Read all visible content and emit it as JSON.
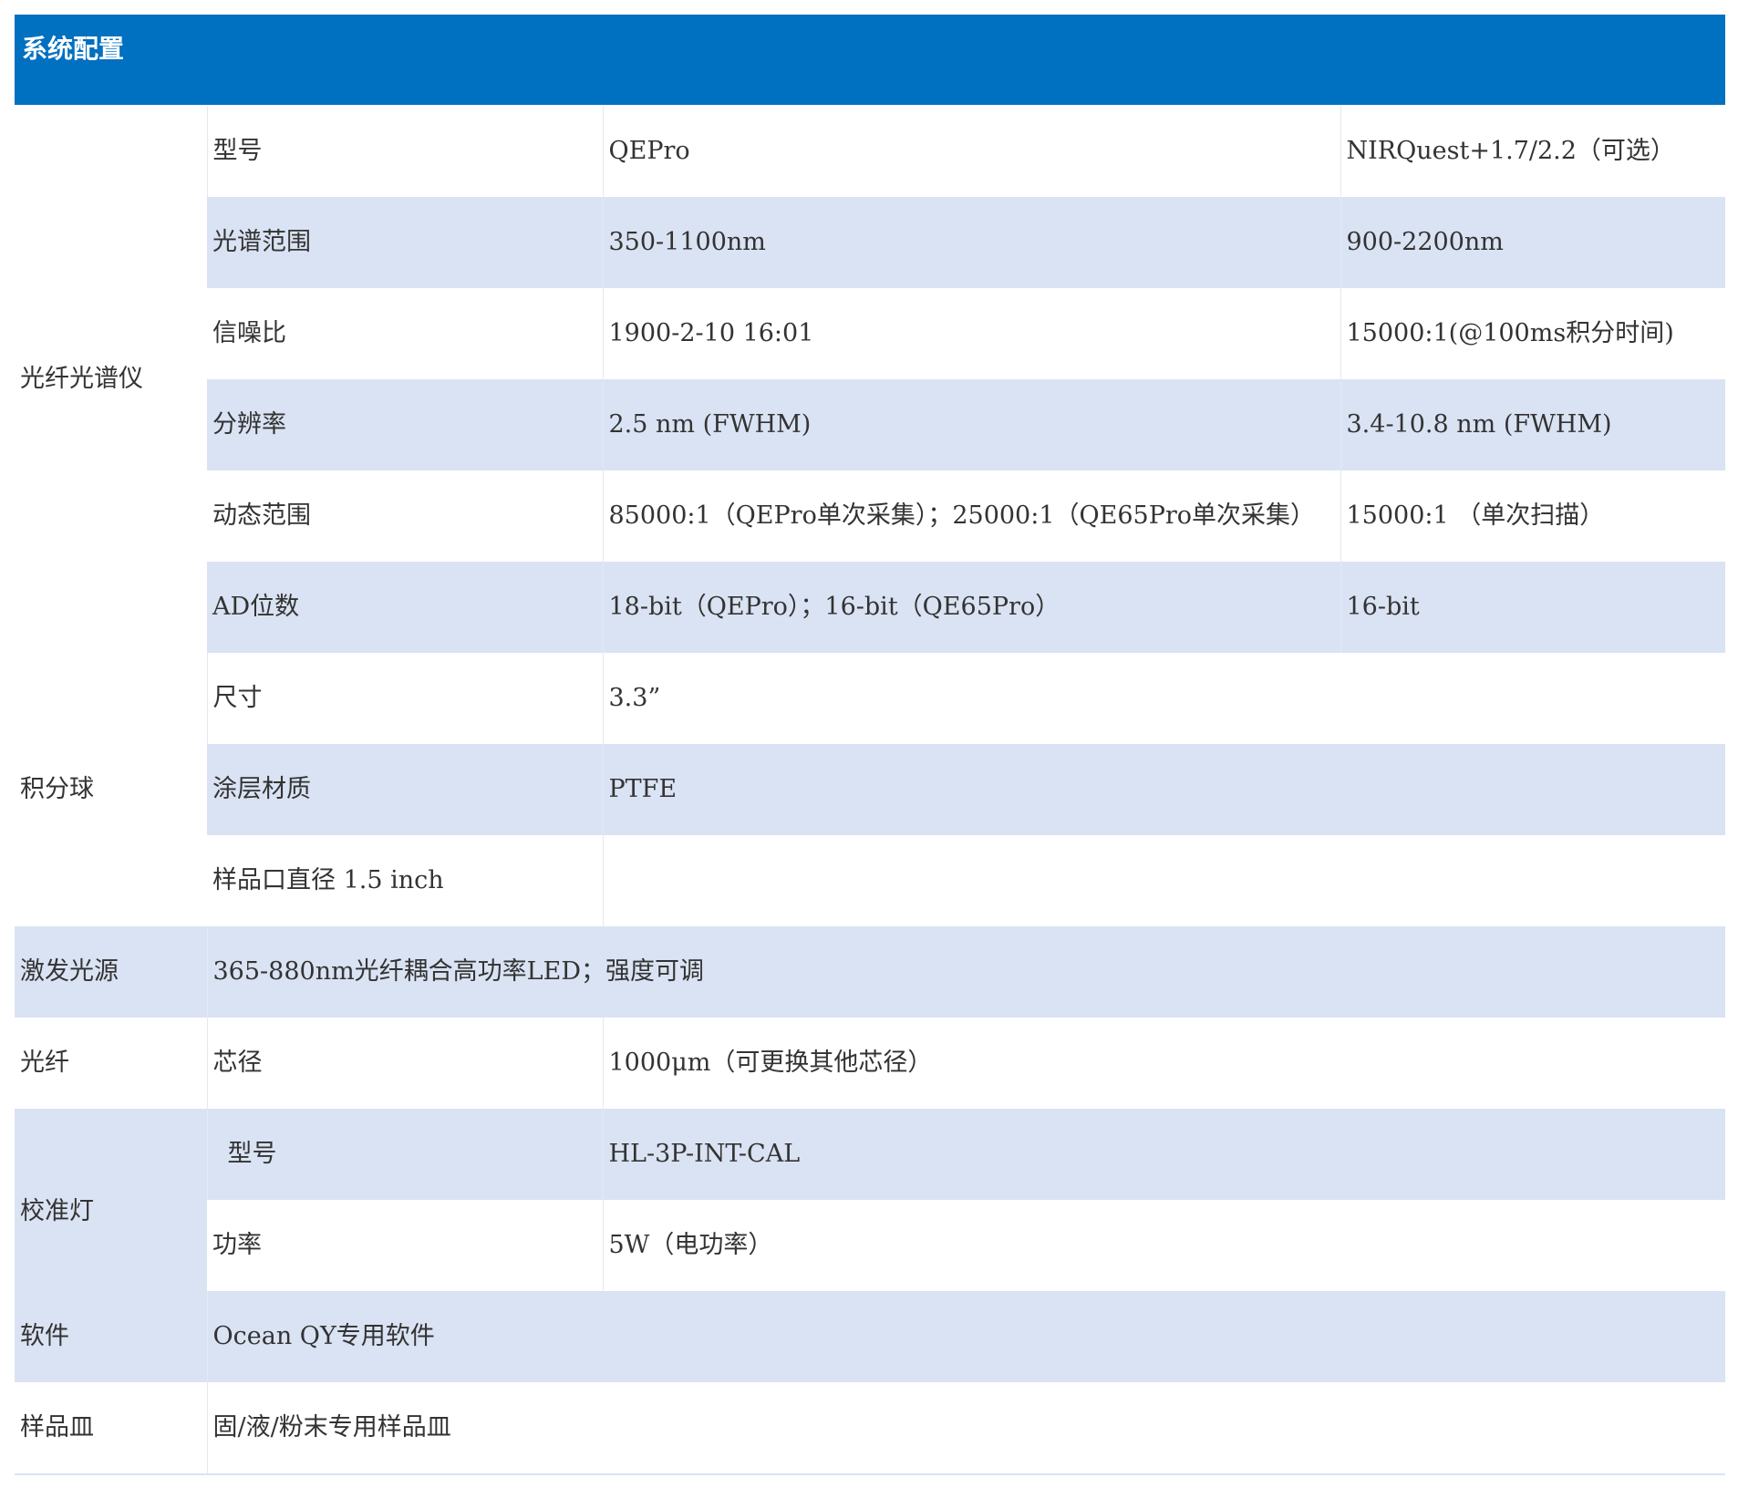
{
  "table": {
    "title": "系统配置",
    "spectrometer": {
      "group": "光纤光谱仪",
      "rows": [
        [
          "型号",
          "QEPro",
          "NIRQuest+1.7/2.2（可选）"
        ],
        [
          "光谱范围",
          "350-1100nm",
          "900-2200nm"
        ],
        [
          "信噪比",
          "1900-2-10 16:01",
          "15000:1(@100ms积分时间)"
        ],
        [
          "分辨率",
          "2.5 nm (FWHM)",
          "3.4-10.8 nm (FWHM)"
        ],
        [
          "动态范围",
          "85000:1（QEPro单次采集）；25000:1（QE65Pro单次采集）",
          "15000:1 （单次扫描）"
        ],
        [
          "AD位数",
          "18-bit（QEPro）；16-bit（QE65Pro）",
          "16-bit"
        ]
      ]
    },
    "sphere": {
      "group": "积分球",
      "rows": [
        [
          "尺寸",
          "3.3”"
        ],
        [
          "涂层材质",
          "PTFE"
        ],
        [
          "样品口直径 1.5 inch",
          ""
        ]
      ]
    },
    "light_source": {
      "group": "激发光源",
      "value": "365-880nm光纤耦合高功率LED；强度可调"
    },
    "fiber": {
      "group": "光纤",
      "label": "芯径",
      "value": "1000μm（可更换其他芯径）"
    },
    "calibration": {
      "group": "校准灯",
      "rows": [
        [
          "型号",
          "HL-3P-INT-CAL"
        ],
        [
          "功率",
          "5W（电功率）"
        ]
      ]
    },
    "software": {
      "group": "软件",
      "value": "Ocean QY专用软件"
    },
    "dish": {
      "group": "样品皿",
      "value": "固/液/粉末专用样品皿"
    }
  }
}
